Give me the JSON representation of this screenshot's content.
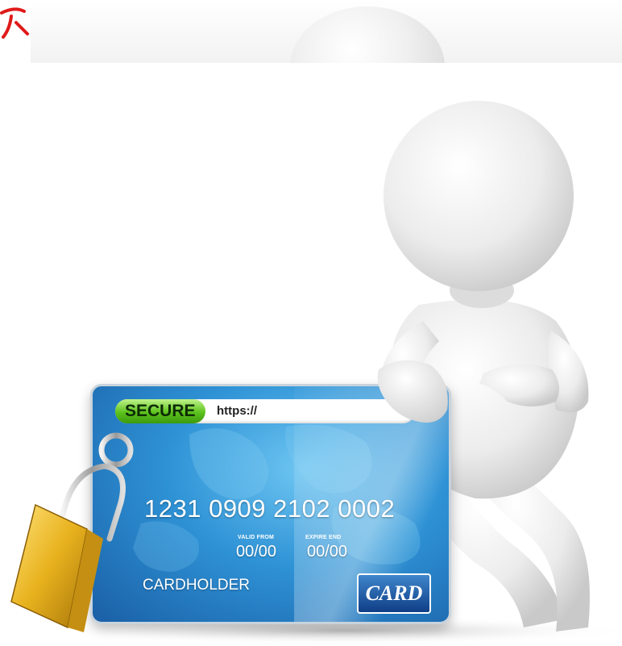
{
  "secure_card": {
    "secure_label": "SECURE",
    "address_text": "https://",
    "number": "1231 0909 2102 0002",
    "valid_from_label": "VALID FROM",
    "valid_from_value": "00/00",
    "expire_label": "EXPIRE END",
    "expire_value": "00/00",
    "holder_label": "CARDHOLDER",
    "badge_text": "CARD"
  },
  "icons": [
    "padlock-icon",
    "white-3d-figure"
  ],
  "colors": {
    "card_blue": "#2f93d6",
    "secure_green": "#5cc21c",
    "padlock_gold": "#e8b21e",
    "corner_mark_red": "#e01a1a"
  }
}
